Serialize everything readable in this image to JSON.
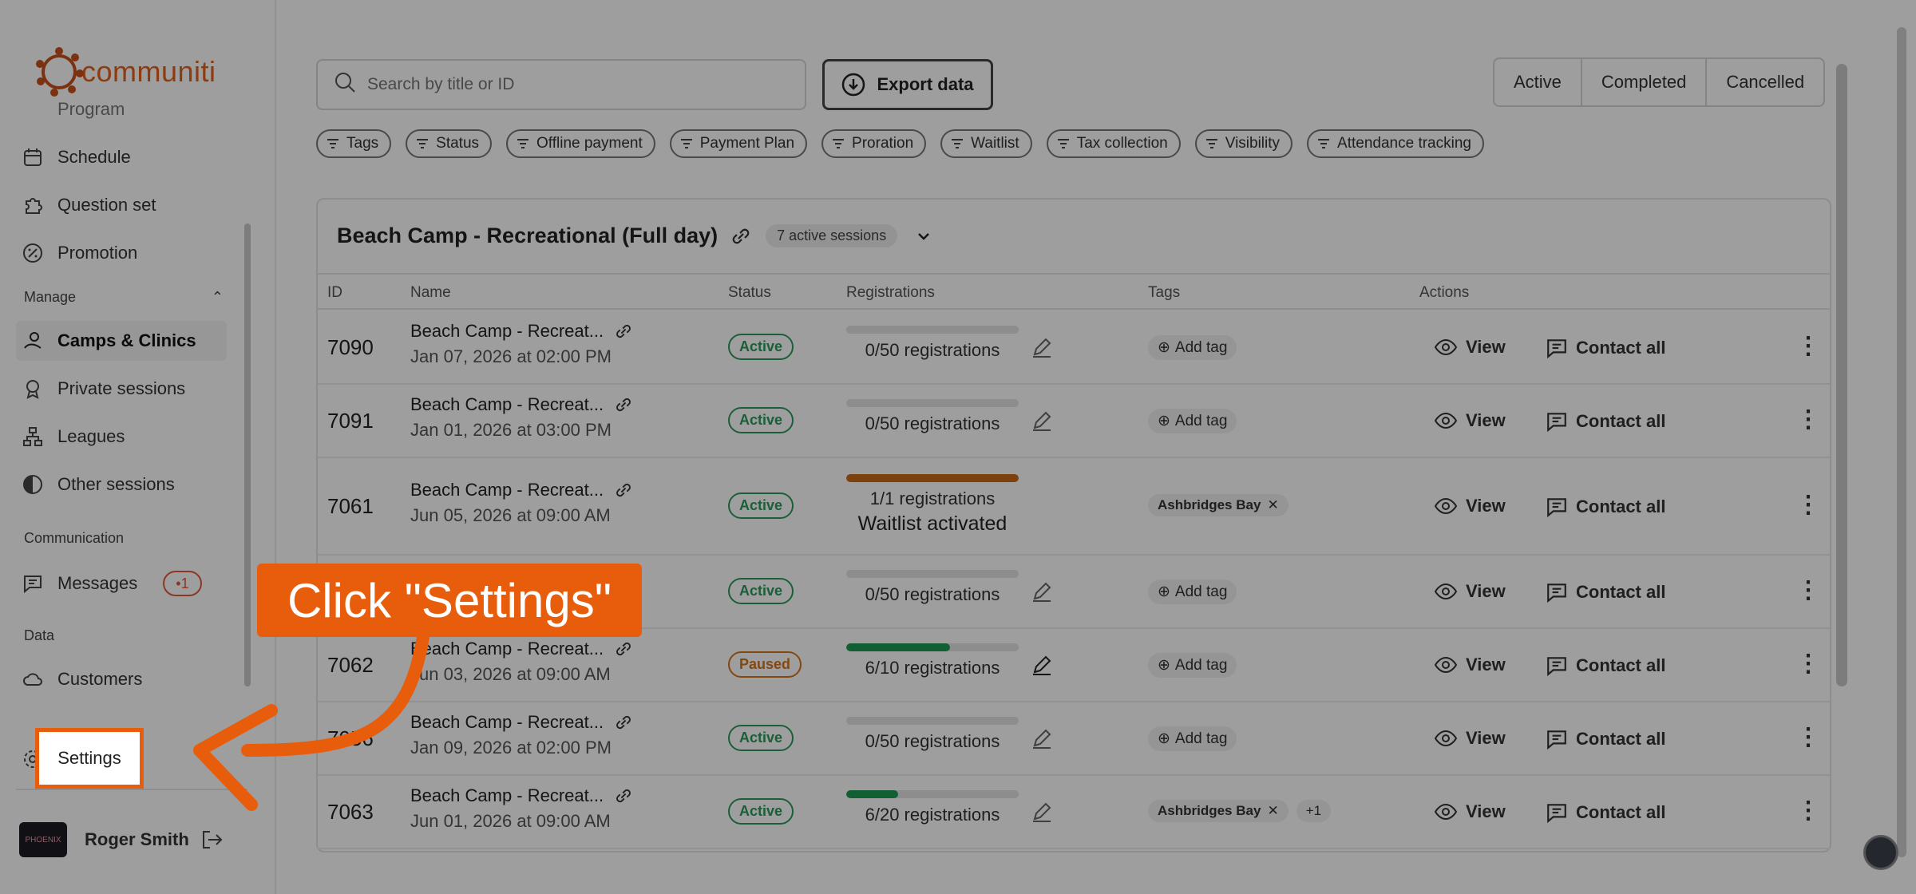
{
  "app": {
    "logo_text": "communiti",
    "accent": "#e2611b"
  },
  "sidebar": {
    "partial_item": "Program",
    "items_top": [
      {
        "label": "Schedule",
        "icon": "calendar-icon"
      },
      {
        "label": "Question set",
        "icon": "puzzle-icon"
      },
      {
        "label": "Promotion",
        "icon": "percent-icon"
      }
    ],
    "manage_label": "Manage",
    "manage_items": [
      {
        "label": "Camps & Clinics",
        "icon": "camp-icon"
      },
      {
        "label": "Private sessions",
        "icon": "medal-icon"
      },
      {
        "label": "Leagues",
        "icon": "bracket-icon"
      },
      {
        "label": "Other sessions",
        "icon": "circle-half-icon"
      }
    ],
    "communication_label": "Communication",
    "messages_label": "Messages",
    "messages_badge": "1",
    "data_label": "Data",
    "customers_label": "Customers",
    "settings_label": "Settings",
    "user_name": "Roger Smith",
    "avatar_text": "PHOENIX"
  },
  "toolbar": {
    "search_placeholder": "Search by title or ID",
    "export_label": "Export data",
    "tabs": [
      "Active",
      "Completed",
      "Cancelled"
    ]
  },
  "filters": [
    "Tags",
    "Status",
    "Offline payment",
    "Payment Plan",
    "Proration",
    "Waitlist",
    "Tax collection",
    "Visibility",
    "Attendance tracking"
  ],
  "card": {
    "title": "Beach Camp - Recreational (Full day)",
    "sessions_badge": "7 active sessions",
    "columns": [
      "ID",
      "Name",
      "Status",
      "Registrations",
      "Tags",
      "Actions"
    ]
  },
  "rows": [
    {
      "id": "7090",
      "name": "Beach Camp - Recreat...",
      "date": "Jan 07, 2026 at 02:00 PM",
      "status": "Active",
      "reg": "0/50 registrations",
      "fill": 0,
      "tags": [],
      "add_tag": "Add tag"
    },
    {
      "id": "7091",
      "name": "Beach Camp - Recreat...",
      "date": "Jan 01, 2026 at 03:00 PM",
      "status": "Active",
      "reg": "0/50 registrations",
      "fill": 0,
      "tags": [],
      "add_tag": "Add tag"
    },
    {
      "id": "7061",
      "name": "Beach Camp - Recreat...",
      "date": "Jun 05, 2026 at 09:00 AM",
      "status": "Active",
      "reg": "1/1 registrations",
      "fill": 1,
      "waitlist": "Waitlist activated",
      "tags": [
        "Ashbridges Bay"
      ]
    },
    {
      "id": "",
      "name": "",
      "date": "",
      "status": "Active",
      "reg": "0/50 registrations",
      "fill": 0,
      "tags": [],
      "add_tag": "Add tag"
    },
    {
      "id": "7062",
      "name": "Beach Camp - Recreat...",
      "date": "Jun 03, 2026 at 09:00 AM",
      "status": "Paused",
      "reg": "6/10 registrations",
      "fill": 0.6,
      "tags": [],
      "add_tag": "Add tag"
    },
    {
      "id": "7056",
      "name": "Beach Camp - Recreat...",
      "date": "Jan 09, 2026 at 02:00 PM",
      "status": "Active",
      "reg": "0/50 registrations",
      "fill": 0,
      "tags": [],
      "add_tag": "Add tag"
    },
    {
      "id": "7063",
      "name": "Beach Camp - Recreat...",
      "date": "Jun 01, 2026 at 09:00 AM",
      "status": "Active",
      "reg": "6/20 registrations",
      "fill": 0.3,
      "tags": [
        "Ashbridges Bay"
      ],
      "more": "+1"
    }
  ],
  "actions": {
    "view": "View",
    "contact": "Contact all"
  },
  "callout": {
    "text": "Click \"Settings\"",
    "color": "#e85d0c"
  }
}
